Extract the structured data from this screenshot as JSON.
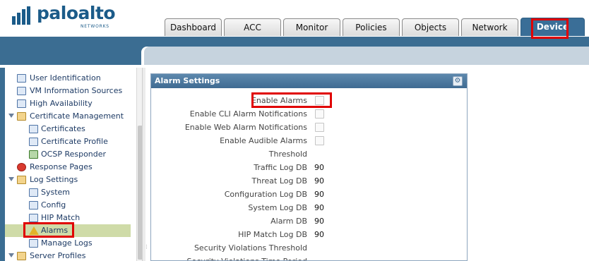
{
  "header": {
    "logo_text": "paloalto",
    "logo_sub": "NETWORKS",
    "tabs": [
      {
        "label": "Dashboard",
        "active": false
      },
      {
        "label": "ACC",
        "active": false
      },
      {
        "label": "Monitor",
        "active": false
      },
      {
        "label": "Policies",
        "active": false
      },
      {
        "label": "Objects",
        "active": false
      },
      {
        "label": "Network",
        "active": false
      },
      {
        "label": "Device",
        "active": true
      }
    ]
  },
  "sidebar": {
    "items": [
      {
        "label": "User Identification",
        "icon": "user-id-icon",
        "level": 0
      },
      {
        "label": "VM Information Sources",
        "icon": "vm-sources-icon",
        "level": 0
      },
      {
        "label": "High Availability",
        "icon": "high-availability-icon",
        "level": 0
      },
      {
        "label": "Certificate Management",
        "icon": "folder-icon",
        "level": 0,
        "expanded": true
      },
      {
        "label": "Certificates",
        "icon": "certificate-icon",
        "level": 1
      },
      {
        "label": "Certificate Profile",
        "icon": "certificate-profile-icon",
        "level": 1
      },
      {
        "label": "OCSP Responder",
        "icon": "ocsp-responder-icon",
        "level": 1
      },
      {
        "label": "Response Pages",
        "icon": "no-entry-icon",
        "level": 0
      },
      {
        "label": "Log Settings",
        "icon": "folder-icon",
        "level": 0,
        "expanded": true
      },
      {
        "label": "System",
        "icon": "system-log-icon",
        "level": 1
      },
      {
        "label": "Config",
        "icon": "config-log-icon",
        "level": 1
      },
      {
        "label": "HIP Match",
        "icon": "hip-match-icon",
        "level": 1
      },
      {
        "label": "Alarms",
        "icon": "alarm-warning-icon",
        "level": 1,
        "selected": true
      },
      {
        "label": "Manage Logs",
        "icon": "manage-logs-icon",
        "level": 1
      },
      {
        "label": "Server Profiles",
        "icon": "folder-icon",
        "level": 0,
        "expanded": true
      }
    ]
  },
  "panel": {
    "title": "Alarm Settings",
    "gear_glyph": "⚙",
    "checkboxes": [
      {
        "label": "Enable Alarms",
        "checked": false
      },
      {
        "label": "Enable CLI Alarm Notifications",
        "checked": false
      },
      {
        "label": "Enable Web Alarm Notifications",
        "checked": false
      },
      {
        "label": "Enable Audible Alarms",
        "checked": false
      }
    ],
    "threshold_label": "Threshold",
    "thresholds": [
      {
        "label": "Traffic Log DB",
        "value": "90"
      },
      {
        "label": "Threat Log DB",
        "value": "90"
      },
      {
        "label": "Configuration Log DB",
        "value": "90"
      },
      {
        "label": "System Log DB",
        "value": "90"
      },
      {
        "label": "Alarm DB",
        "value": "90"
      },
      {
        "label": "HIP Match Log DB",
        "value": "90"
      }
    ],
    "security_violations_threshold_label": "Security Violations Threshold",
    "security_violations_time_period_label": "Security Violations Time Period"
  },
  "colors": {
    "accent": "#3b6d92",
    "highlight_annotation": "#e00000",
    "selected_row": "#cfdba8"
  }
}
